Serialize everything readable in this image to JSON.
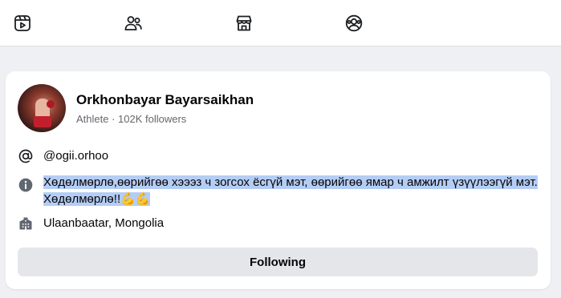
{
  "nav": {
    "items": [
      {
        "name": "video",
        "icon": "video-play-icon"
      },
      {
        "name": "friends",
        "icon": "friends-icon"
      },
      {
        "name": "marketplace",
        "icon": "marketplace-store-icon"
      },
      {
        "name": "profile",
        "icon": "profile-circle-icon"
      }
    ]
  },
  "profile": {
    "name": "Orkhonbayar Bayarsaikhan",
    "subtitle": "Athlete · 102K followers",
    "handle": "@ogii.orhoo",
    "bio": "Хөдөлмөрлө,өөрийгөө хэээз ч зогсох ёсгүй мэт, өөрийгөө ямар ч амжилт үзүүлээгүй мэт. Хөдөлмөрлө!!💪💪",
    "location": "Ulaanbaatar, Mongolia",
    "follow_button_label": "Following"
  },
  "colors": {
    "background": "#eff0f3",
    "card": "#ffffff",
    "button": "#e4e6ea",
    "selection_highlight": "#b4cdf5",
    "secondary_text": "#65676b"
  }
}
